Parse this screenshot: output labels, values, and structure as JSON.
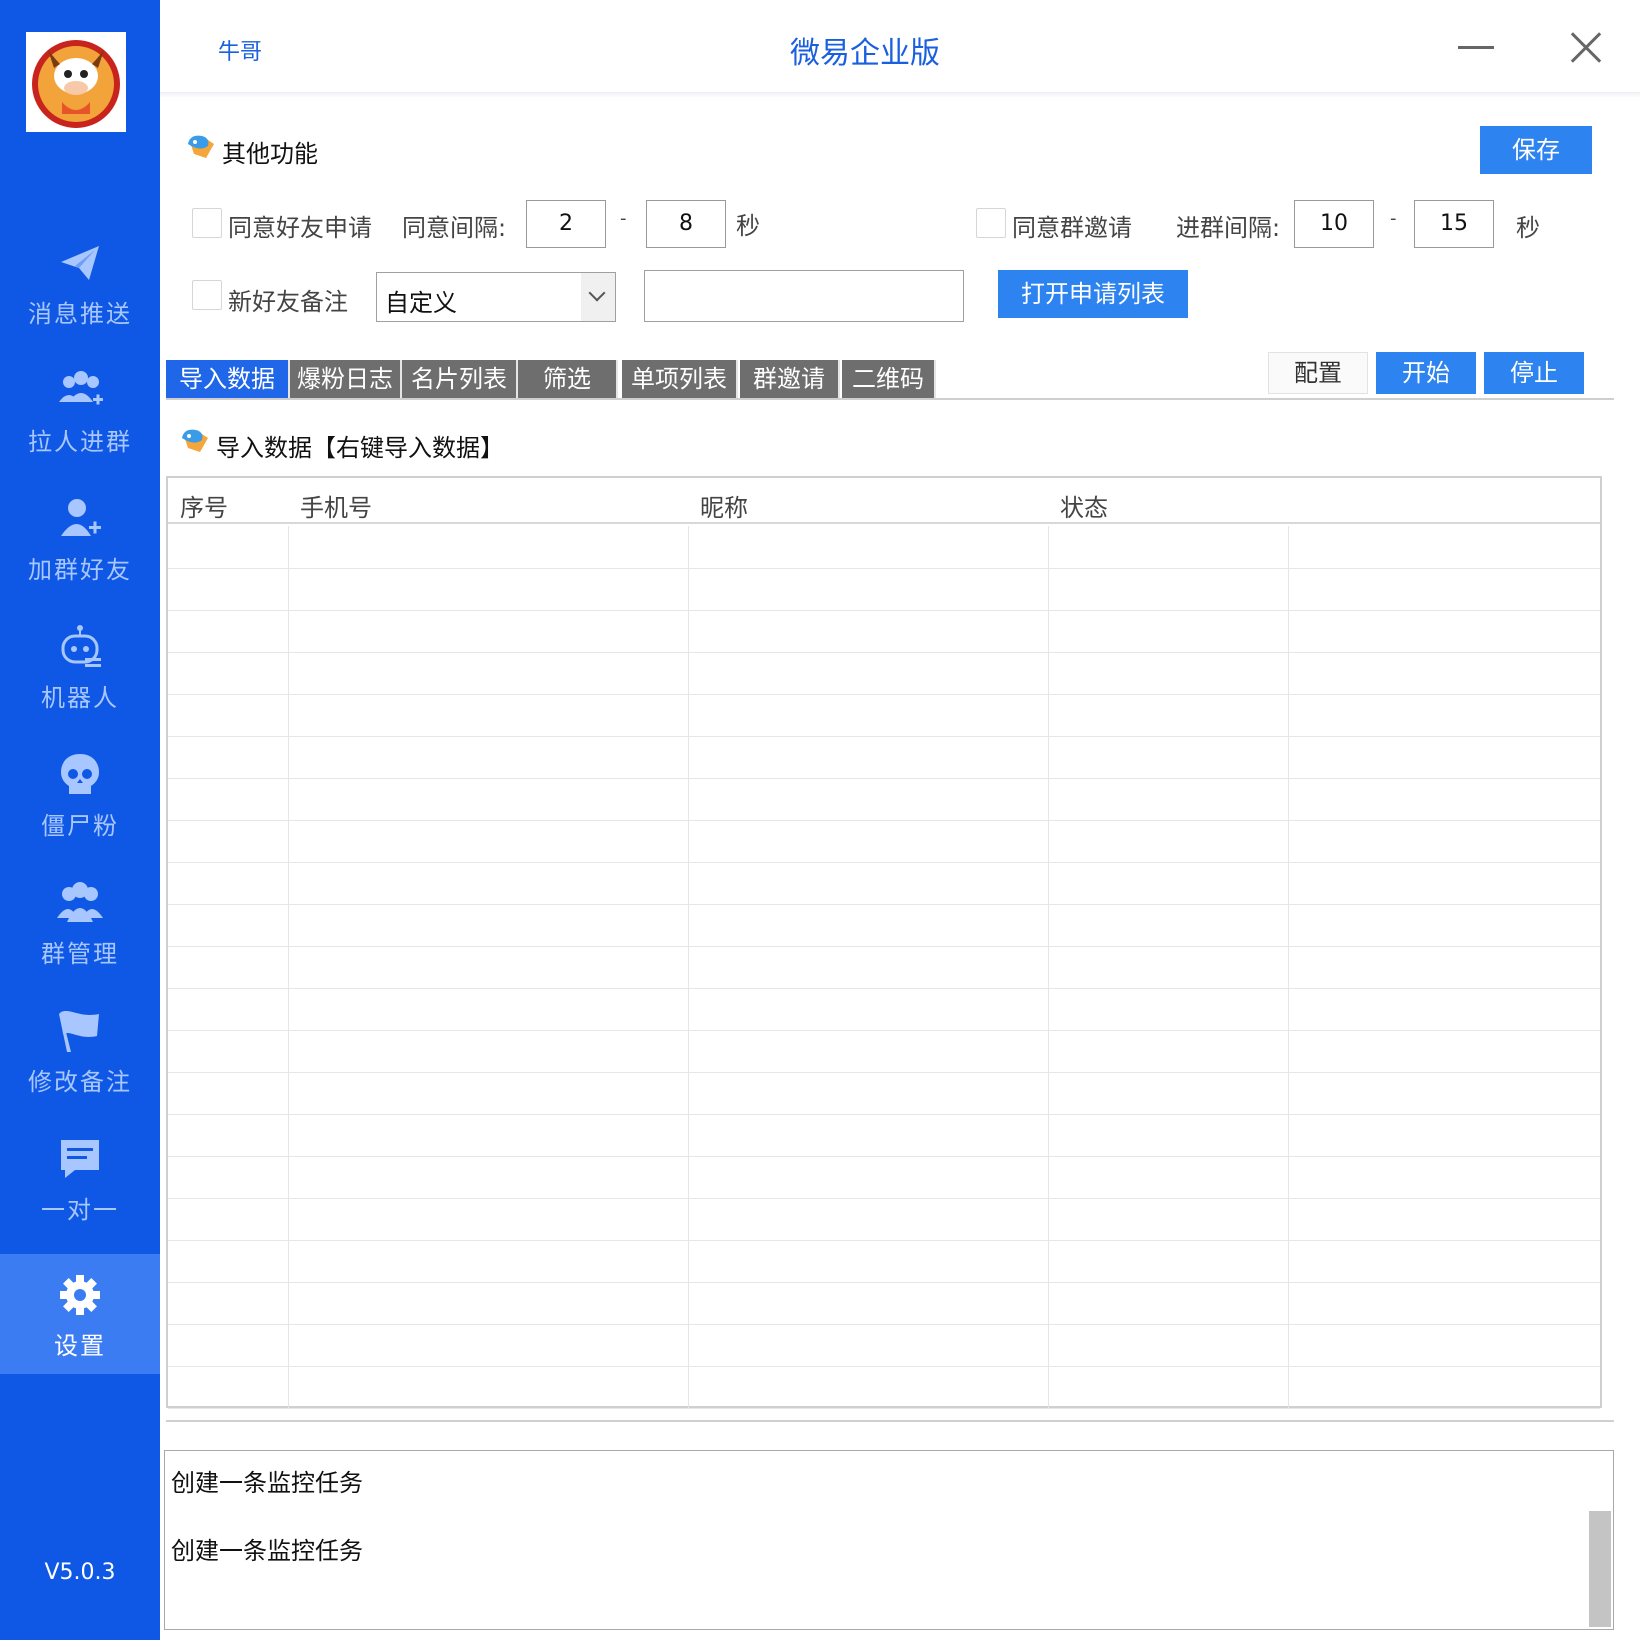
{
  "window": {
    "user": "牛哥",
    "title": "微易企业版"
  },
  "sidebar": {
    "items": [
      {
        "label": "消息推送"
      },
      {
        "label": "拉人进群"
      },
      {
        "label": "加群好友"
      },
      {
        "label": "机器人"
      },
      {
        "label": "僵尸粉"
      },
      {
        "label": "群管理"
      },
      {
        "label": "修改备注"
      },
      {
        "label": "一对一"
      },
      {
        "label": "设置"
      }
    ],
    "active_index": 8,
    "version": "V5.0.3"
  },
  "other": {
    "title": "其他功能",
    "save_label": "保存",
    "agree_friend_label": "同意好友申请",
    "agree_interval_label": "同意间隔:",
    "agree_min": "2",
    "agree_max": "8",
    "dash": "-",
    "sec_label": "秒",
    "agree_group_label": "同意群邀请",
    "join_interval_label": "进群间隔:",
    "join_min": "10",
    "join_max": "15",
    "new_friend_remark_label": "新好友备注",
    "remark_select_value": "自定义",
    "remark_input_value": "",
    "open_list_label": "打开申请列表"
  },
  "tabs": [
    {
      "label": "导入数据",
      "active": true
    },
    {
      "label": "爆粉日志",
      "active": false
    },
    {
      "label": "名片列表",
      "active": false
    },
    {
      "label": "筛选",
      "active": false
    },
    {
      "label": "单项列表",
      "active": false
    },
    {
      "label": "群邀请",
      "active": false
    },
    {
      "label": "二维码",
      "active": false
    }
  ],
  "actions": {
    "config_label": "配置",
    "start_label": "开始",
    "stop_label": "停止"
  },
  "import": {
    "title": "导入数据【右键导入数据】",
    "columns": [
      "序号",
      "手机号",
      "昵称",
      "状态"
    ],
    "rows": []
  },
  "log": {
    "lines": [
      "创建一条监控任务",
      "创建一条监控任务"
    ]
  },
  "colors": {
    "sidebar": "#0f58e6",
    "accent": "#2d83f0",
    "tab_active": "#1f66e8",
    "tab_inactive": "#6e6e6e"
  }
}
